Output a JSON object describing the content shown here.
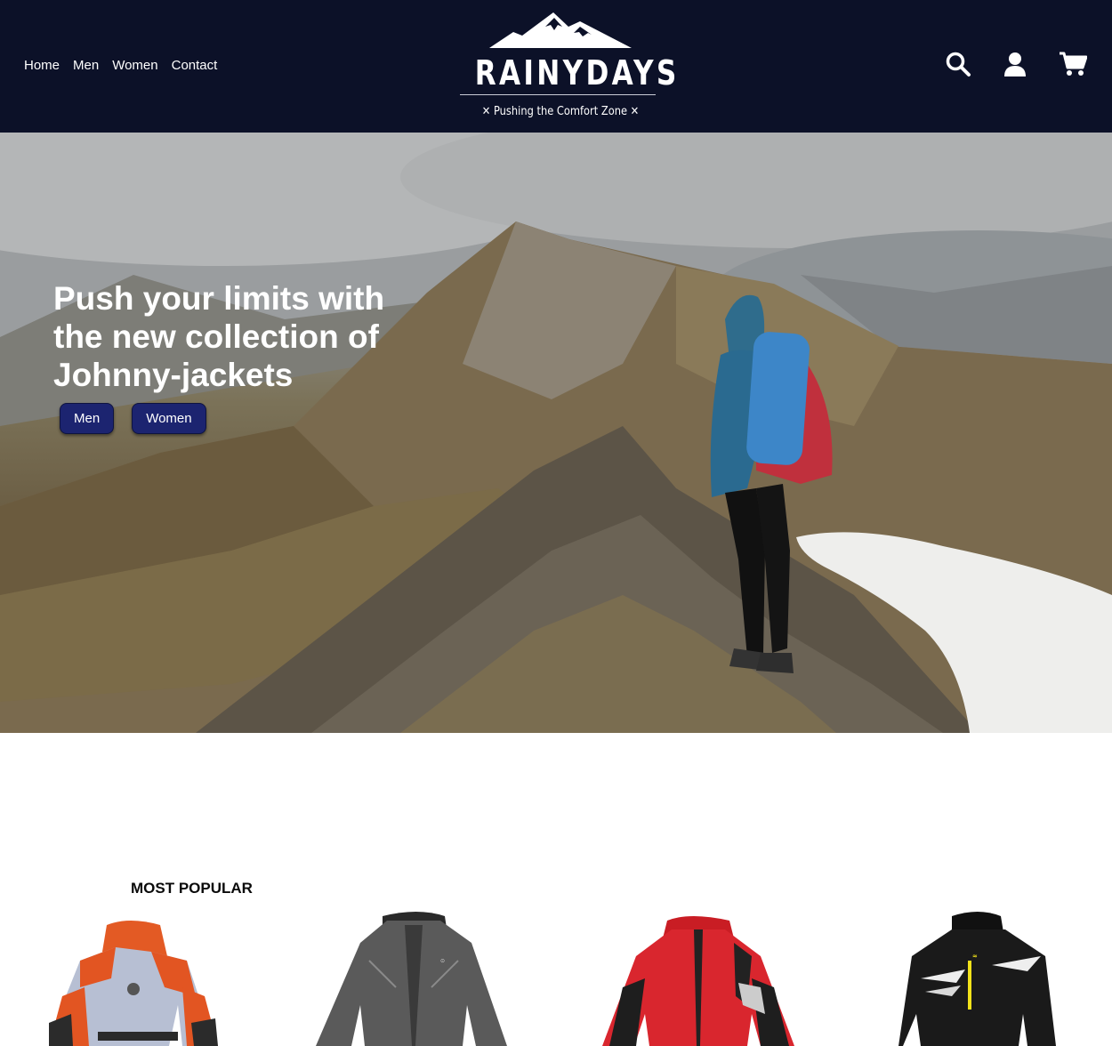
{
  "nav": {
    "items": [
      "Home",
      "Men",
      "Women",
      "Contact"
    ]
  },
  "logo": {
    "name": "RAINYDAYS",
    "tagline": "✕ Pushing the Comfort Zone ✕"
  },
  "header_icons": [
    "search-icon",
    "user-icon",
    "cart-icon"
  ],
  "hero": {
    "title": "Push your limits with the new collection of Johnny-jackets",
    "buttons": [
      "Men",
      "Women"
    ]
  },
  "popular": {
    "title": "MOST POPULAR",
    "products": [
      "orange-grey-jacket",
      "grey-jacket",
      "red-jacket",
      "black-jacket"
    ]
  },
  "colors": {
    "header_bg": "#0c1128",
    "button_bg": "#1c2470"
  }
}
